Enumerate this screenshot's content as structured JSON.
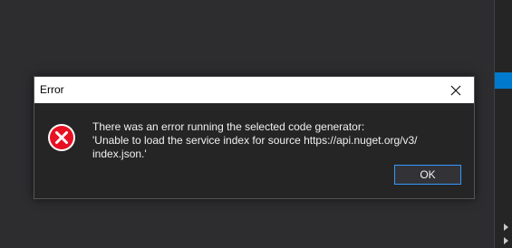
{
  "dialog": {
    "title": "Error",
    "close_icon": "close-icon",
    "icon": "error-icon",
    "message_lines": [
      "There was an error running the selected code generator:",
      "'Unable to load the service index for source https://api.nuget.org/v3/",
      "index.json.'"
    ],
    "ok_label": "OK"
  },
  "theme": {
    "ide_background": "#2d2d30",
    "dialog_background": "#252526",
    "titlebar_background": "#ffffff",
    "accent": "#007acc",
    "focus_border": "#3399ff",
    "error_red": "#e81123"
  }
}
